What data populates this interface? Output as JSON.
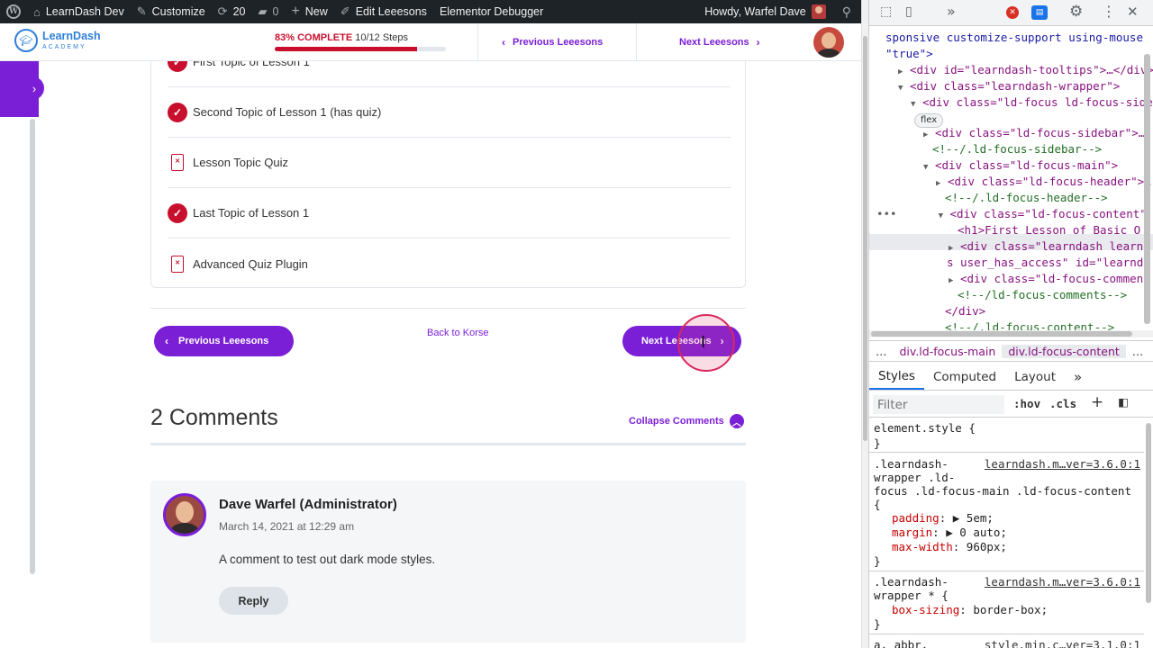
{
  "adminbar": {
    "site_name": "LearnDash Dev",
    "customize": "Customize",
    "updates_count": "20",
    "comments_count": "0",
    "new_label": "New",
    "edit_label": "Edit Leeesons",
    "debugger_label": "Elementor Debugger",
    "howdy": "Howdy, Warfel Dave",
    "icons": [
      "wordpress-logo-icon",
      "home-icon",
      "brush-icon",
      "refresh-icon",
      "comment-icon",
      "plus-icon",
      "pencil-icon",
      "search-icon"
    ]
  },
  "header": {
    "logo_title": "LearnDash",
    "logo_sub": "ACADEMY",
    "progress_percent_label": "83% COMPLETE",
    "progress_steps": "10/12 Steps",
    "progress_value": 0.83,
    "prev_label": "Previous Leeesons",
    "next_label": "Next Leeesons"
  },
  "topics": [
    {
      "label": "First Topic of Lesson 1",
      "type": "complete"
    },
    {
      "label": "Second Topic of Lesson 1 (has quiz)",
      "type": "complete"
    },
    {
      "label": "Lesson Topic Quiz",
      "type": "quiz"
    },
    {
      "label": "Last Topic of Lesson 1",
      "type": "complete"
    },
    {
      "label": "Advanced Quiz Plugin",
      "type": "quiz"
    }
  ],
  "nav": {
    "prev_label": "Previous Leeesons",
    "back_label": "Back to Korse",
    "next_label": "Next Leeesons"
  },
  "comments": {
    "title": "2 Comments",
    "collapse_label": "Collapse Comments",
    "items": [
      {
        "author": "Dave Warfel (Administrator)",
        "date": "March 14, 2021 at 12:29 am",
        "text": "A comment to test out dark mode styles.",
        "reply_label": "Reply"
      }
    ]
  },
  "devtools": {
    "toolbar_icons": [
      "inspect-icon",
      "device-toolbar-icon",
      "more-tabs-icon",
      "error-badge-icon",
      "message-badge-icon",
      "settings-gear-icon",
      "kebab-menu-icon",
      "close-icon"
    ],
    "error_count": "",
    "dom_lines": [
      {
        "text": "sponsive customize-support using-mouse",
        "cls": "t-val"
      },
      {
        "text": "\"true\">",
        "cls": "t-val"
      },
      {
        "text": "<div id=\"learndash-tooltips\">…</div>",
        "cls": "t-tag"
      },
      {
        "text": "<div class=\"learndash-wrapper\">",
        "cls": "t-tag"
      },
      {
        "text": "<div class=\"ld-focus ld-focus-sidebar",
        "cls": "t-tag"
      },
      {
        "text": "flex",
        "cls": "badge"
      },
      {
        "text": "<div class=\"ld-focus-sidebar\">…",
        "cls": "t-tag"
      },
      {
        "text": "<!--/.ld-focus-sidebar-->",
        "cls": "t-com"
      },
      {
        "text": "<div class=\"ld-focus-main\">",
        "cls": "t-tag"
      },
      {
        "text": "<div class=\"ld-focus-header\">…",
        "cls": "t-tag"
      },
      {
        "text": "<!--/.ld-focus-header-->",
        "cls": "t-com"
      },
      {
        "text": "<div class=\"ld-focus-content\"",
        "cls": "t-tag"
      },
      {
        "text": "<h1>First Lesson of Basic O",
        "cls": "t-tag"
      },
      {
        "text": "<div class=\"learndash learn",
        "cls": "t-tag"
      },
      {
        "text": "s user_has_access\" id=\"learnd",
        "cls": "t-tag"
      },
      {
        "text": "<div class=\"ld-focus-comment",
        "cls": "t-tag"
      },
      {
        "text": "<!--/ld-focus-comments-->",
        "cls": "t-com"
      },
      {
        "text": "</div>",
        "cls": "t-tag"
      },
      {
        "text": "<!--/.ld-focus-content-->",
        "cls": "t-com"
      }
    ],
    "crumbs": [
      "…",
      "div.ld-focus-main",
      "div.ld-focus-content",
      "…"
    ],
    "tabs": [
      "Styles",
      "Computed",
      "Layout",
      "»"
    ],
    "filter_placeholder": "Filter",
    "hov_label": ":hov",
    "cls_label": ".cls",
    "element_style_open": "element.style {",
    "element_style_close": "}",
    "rule1": {
      "selector": [
        ".learndash-",
        "wrapper .ld-",
        "focus .ld-focus-main .ld-focus-content",
        "{"
      ],
      "source": "learndash.m…ver=3.6.0:1",
      "props": [
        {
          "name": "padding",
          "value": "▶ 5em;"
        },
        {
          "name": "margin",
          "value": "▶ 0 auto;"
        },
        {
          "name": "max-width",
          "value": "960px;"
        }
      ],
      "close": "}"
    },
    "rule2": {
      "selector": [
        ".learndash-",
        "wrapper * {"
      ],
      "source": "learndash.m…ver=3.6.0:1",
      "props": [
        {
          "name": "box-sizing",
          "value": "border-box;"
        }
      ],
      "close": "}"
    },
    "rule3": {
      "selector": "a, abbr,",
      "source": "style.min.c…ver=3.1.0:1"
    }
  }
}
